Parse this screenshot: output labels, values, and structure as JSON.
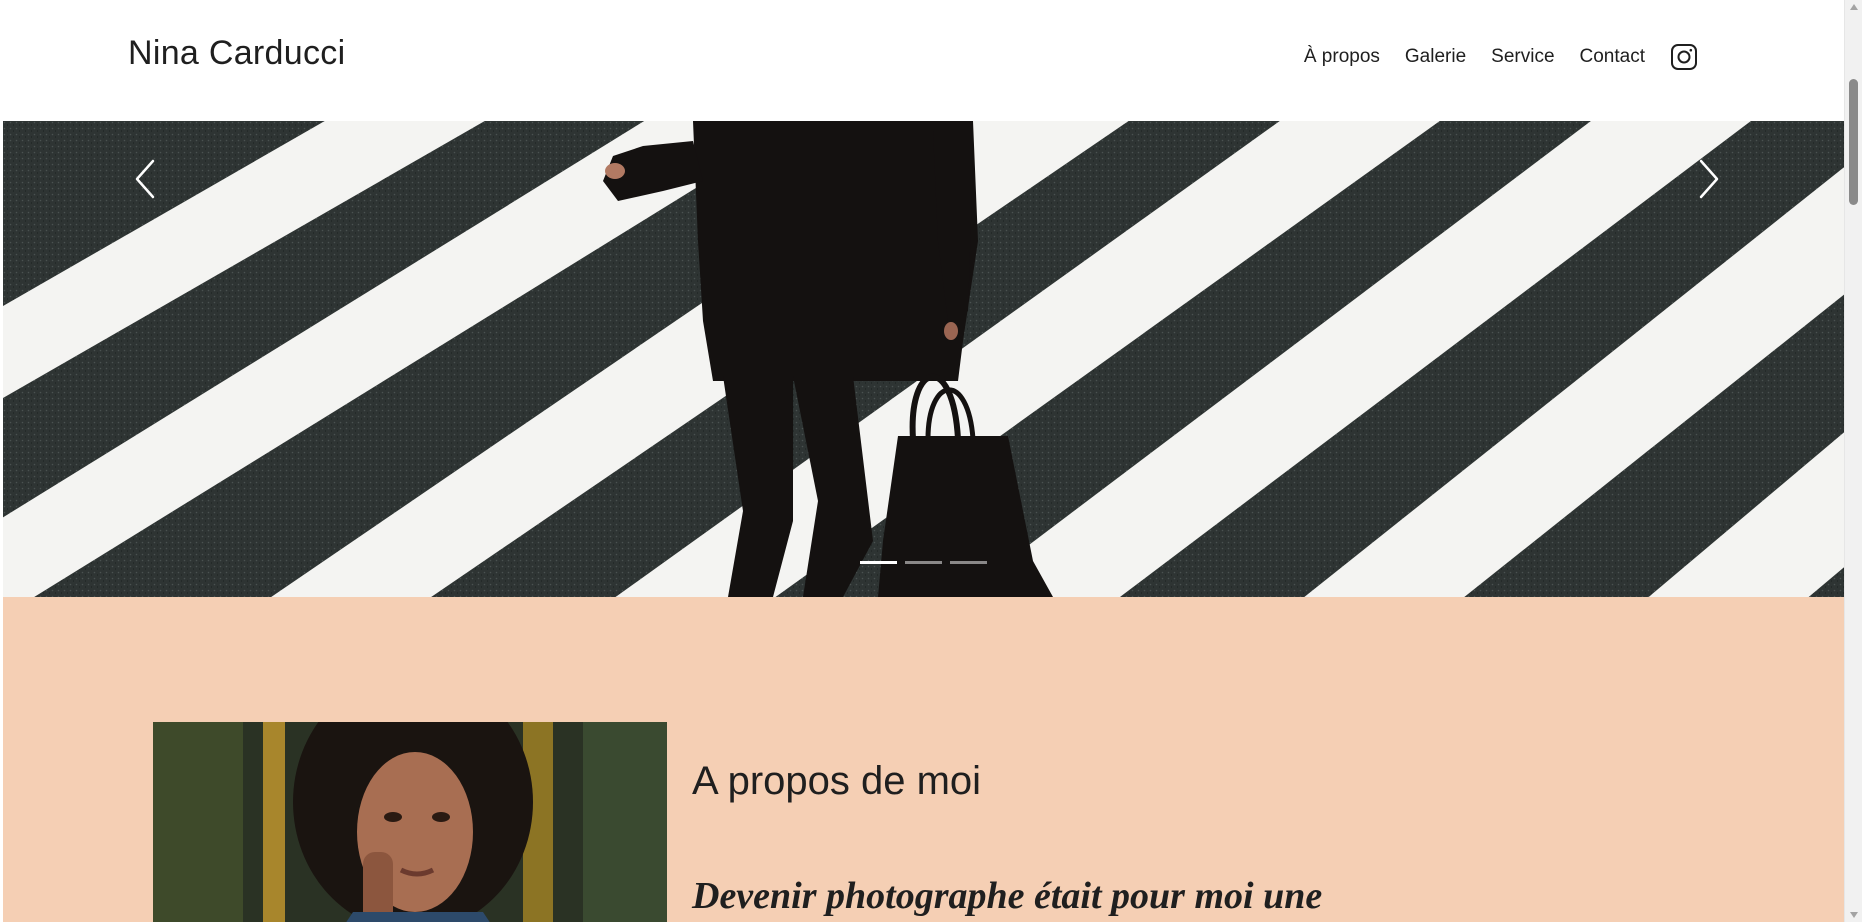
{
  "header": {
    "brand": "Nina Carducci",
    "nav": [
      {
        "label": "À propos"
      },
      {
        "label": "Galerie"
      },
      {
        "label": "Service"
      },
      {
        "label": "Contact"
      }
    ],
    "social_icon": "instagram-icon"
  },
  "carousel": {
    "prev_icon": "chevron-left-icon",
    "next_icon": "chevron-right-icon",
    "slide_count": 3,
    "active_slide": 1
  },
  "about": {
    "title": "A propos de moi",
    "quote": "Devenir photographe était pour moi une"
  },
  "colors": {
    "about_background": "#f5cfb4",
    "text": "#1f1f1f",
    "header_background": "#ffffff"
  }
}
